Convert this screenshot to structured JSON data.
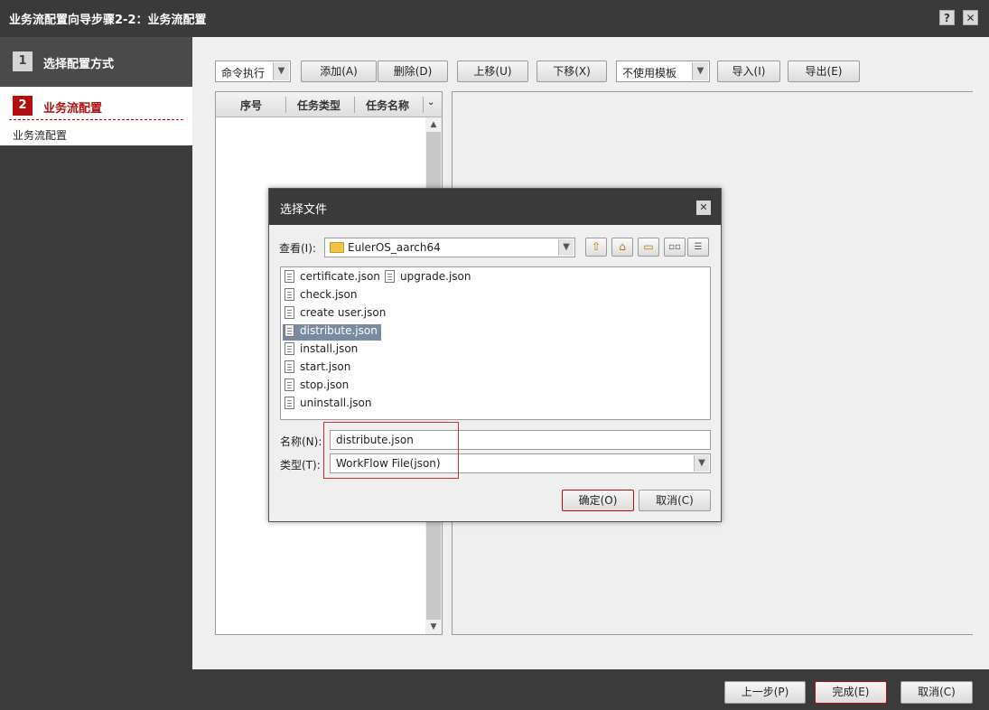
{
  "window": {
    "title": "业务流配置向导步骤2-2：业务流配置",
    "help_label": "?",
    "close_label": "✕"
  },
  "sidebar": {
    "steps": [
      {
        "number": "1",
        "label": "选择配置方式"
      },
      {
        "number": "2",
        "label": "业务流配置",
        "sub": "业务流配置"
      }
    ]
  },
  "toolbar": {
    "mode_select": "命令执行",
    "add": "添加(A)",
    "delete": "删除(D)",
    "move_up": "上移(U)",
    "move_down": "下移(X)",
    "template_select": "不使用模板",
    "import": "导入(I)",
    "export": "导出(E)"
  },
  "grid": {
    "columns": [
      "序号",
      "任务类型",
      "任务名称"
    ]
  },
  "dialog": {
    "title": "选择文件",
    "close_label": "✕",
    "look_in_label": "查看(I):",
    "look_in_value": "EulerOS_aarch64",
    "files": [
      "certificate.json",
      "upgrade.json",
      "check.json",
      "create user.json",
      "distribute.json",
      "install.json",
      "start.json",
      "stop.json",
      "uninstall.json"
    ],
    "selected_file": "distribute.json",
    "name_label": "名称(N):",
    "name_value": "distribute.json",
    "type_label": "类型(T):",
    "type_value": "WorkFlow File(json)",
    "ok": "确定(O)",
    "cancel": "取消(C)"
  },
  "footer": {
    "prev": "上一步(P)",
    "finish": "完成(E)",
    "cancel": "取消(C)"
  },
  "colors": {
    "accent_red": "#b20f0f",
    "dark_bg": "#3b3b3b",
    "selection": "#7a8aa0"
  }
}
